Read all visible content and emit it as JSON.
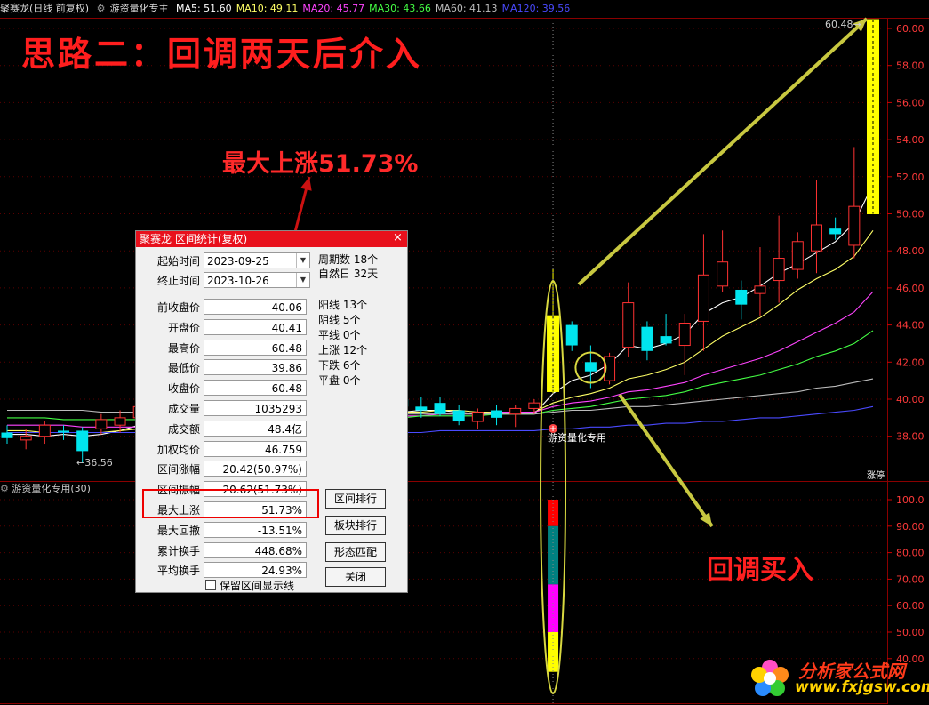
{
  "header": {
    "stock": "聚赛龙",
    "period": "(日线 前复权)",
    "indicator": "游资量化专主",
    "ma": [
      {
        "label": "MA5: 51.60",
        "color": "#ffffff"
      },
      {
        "label": "MA10: 49.11",
        "color": "#ffff66"
      },
      {
        "label": "MA20: 45.77",
        "color": "#ff44ff"
      },
      {
        "label": "MA30: 43.66",
        "color": "#44ff44"
      },
      {
        "label": "MA60: 41.13",
        "color": "#bbbbbb"
      },
      {
        "label": "MA120: 39.56",
        "color": "#4a4aff"
      }
    ]
  },
  "sub_panel_title": "游资量化专用(30)",
  "big_title": "思路二：回调两天后介入",
  "anno_max": "最大上涨51.73%",
  "anno_buy": "回调买入",
  "signal_label": "游资量化专用",
  "low_label": "36.56",
  "high_label": "60.48",
  "zhangting_label": "涨停",
  "dialog": {
    "title": "聚赛龙 区间统计(复权)",
    "close": "×",
    "start_label": "起始时间",
    "start_value": "2023-09-25",
    "end_label": "终止时间",
    "end_value": "2023-10-26",
    "fields": [
      {
        "label": "前收盘价",
        "value": "40.06"
      },
      {
        "label": "开盘价",
        "value": "40.41"
      },
      {
        "label": "最高价",
        "value": "60.48"
      },
      {
        "label": "最低价",
        "value": "39.86"
      },
      {
        "label": "收盘价",
        "value": "60.48"
      },
      {
        "label": "成交量",
        "value": "1035293"
      },
      {
        "label": "成交额",
        "value": "48.4亿"
      },
      {
        "label": "加权均价",
        "value": "46.759"
      },
      {
        "label": "区间涨幅",
        "value": "20.42(50.97%)"
      },
      {
        "label": "区间振幅",
        "value": "20.62(51.73%)"
      },
      {
        "label": "最大上涨",
        "value": "51.73%"
      },
      {
        "label": "最大回撤",
        "value": "-13.51%"
      },
      {
        "label": "累计换手",
        "value": "448.68%"
      },
      {
        "label": "平均换手",
        "value": "24.93%"
      }
    ],
    "stats": [
      "周期数 18个",
      "自然日 32天",
      "阳线 13个",
      "阴线 5个",
      "平线 0个",
      "上涨 12个",
      "下跌 6个",
      "平盘 0个"
    ],
    "buttons": [
      "区间排行",
      "板块排行",
      "形态匹配",
      "关闭"
    ],
    "checkbox_label": "保留区间显示线"
  },
  "logo": {
    "name": "分析家公式网",
    "url": "www.fxjgsw.com"
  },
  "chart_data": {
    "type": "candlestick",
    "y_ticks_main": [
      "60.00",
      "58.00",
      "56.00",
      "54.00",
      "52.00",
      "50.00",
      "48.00",
      "46.00",
      "44.00",
      "42.00",
      "40.00",
      "38.00"
    ],
    "y_ticks_sub": [
      "100.0",
      "90.00",
      "80.00",
      "70.00",
      "60.00",
      "50.00",
      "40.00"
    ],
    "ylim_main": [
      36,
      61
    ],
    "ylim_sub": [
      35,
      105
    ],
    "up_color": "#ff3232",
    "down_color": "#00e5ee",
    "candles": [
      {
        "o": 38.2,
        "h": 38.6,
        "l": 37.6,
        "c": 37.9
      },
      {
        "o": 37.8,
        "h": 38.4,
        "l": 37.3,
        "c": 38.0
      },
      {
        "o": 38.0,
        "h": 38.8,
        "l": 37.6,
        "c": 38.6
      },
      {
        "o": 38.3,
        "h": 38.6,
        "l": 37.8,
        "c": 38.2
      },
      {
        "o": 38.3,
        "h": 38.5,
        "l": 36.56,
        "c": 37.2
      },
      {
        "o": 38.4,
        "h": 39.2,
        "l": 38.1,
        "c": 38.9
      },
      {
        "o": 38.6,
        "h": 39.4,
        "l": 38.2,
        "c": 39.0
      },
      {
        "o": 39.0,
        "h": 40.1,
        "l": 38.6,
        "c": 39.6
      },
      {
        "o": 40.0,
        "h": 40.2,
        "l": 38.7,
        "c": 39.3
      },
      {
        "o": 39.8,
        "h": 40.1,
        "l": 39.3,
        "c": 39.5
      },
      {
        "o": 39.6,
        "h": 40.2,
        "l": 38.9,
        "c": 38.9
      },
      {
        "o": 39.0,
        "h": 39.5,
        "l": 38.4,
        "c": 38.7
      },
      {
        "o": 38.6,
        "h": 39.2,
        "l": 38.3,
        "c": 39.1
      },
      {
        "o": 39.2,
        "h": 39.8,
        "l": 38.9,
        "c": 38.9
      },
      {
        "o": 39.0,
        "h": 39.5,
        "l": 38.5,
        "c": 39.4
      },
      {
        "o": 39.4,
        "h": 40.0,
        "l": 38.6,
        "c": 39.8
      },
      {
        "o": 40.0,
        "h": 40.3,
        "l": 39.0,
        "c": 39.3
      },
      {
        "o": 39.3,
        "h": 40.0,
        "l": 38.5,
        "c": 39.6
      },
      {
        "o": 39.8,
        "h": 40.3,
        "l": 38.6,
        "c": 39.1
      },
      {
        "o": 39.2,
        "h": 39.8,
        "l": 38.8,
        "c": 38.9
      },
      {
        "o": 39.0,
        "h": 39.8,
        "l": 38.6,
        "c": 39.4
      },
      {
        "o": 40.0,
        "h": 40.3,
        "l": 39.4,
        "c": 39.6
      },
      {
        "o": 39.6,
        "h": 40.1,
        "l": 39.0,
        "c": 39.4
      },
      {
        "o": 39.8,
        "h": 40.1,
        "l": 39.1,
        "c": 39.2
      },
      {
        "o": 39.4,
        "h": 39.7,
        "l": 38.6,
        "c": 38.8
      },
      {
        "o": 38.8,
        "h": 39.5,
        "l": 38.4,
        "c": 39.3
      },
      {
        "o": 39.4,
        "h": 39.7,
        "l": 38.6,
        "c": 39.0
      },
      {
        "o": 39.2,
        "h": 39.7,
        "l": 38.5,
        "c": 39.5
      },
      {
        "o": 39.5,
        "h": 40.0,
        "l": 39.2,
        "c": 39.8
      },
      {
        "o": 40.41,
        "h": 47.0,
        "l": 40.3,
        "c": 44.5
      },
      {
        "o": 44.0,
        "h": 44.2,
        "l": 42.6,
        "c": 42.9
      },
      {
        "o": 42.0,
        "h": 42.9,
        "l": 40.6,
        "c": 41.5
      },
      {
        "o": 41.0,
        "h": 42.5,
        "l": 40.8,
        "c": 42.3
      },
      {
        "o": 42.8,
        "h": 46.3,
        "l": 42.3,
        "c": 45.2
      },
      {
        "o": 43.9,
        "h": 44.2,
        "l": 42.1,
        "c": 42.6
      },
      {
        "o": 43.4,
        "h": 44.6,
        "l": 42.9,
        "c": 43.0
      },
      {
        "o": 42.9,
        "h": 44.6,
        "l": 41.3,
        "c": 44.1
      },
      {
        "o": 44.2,
        "h": 48.9,
        "l": 42.6,
        "c": 46.7
      },
      {
        "o": 46.1,
        "h": 49.1,
        "l": 45.8,
        "c": 47.4
      },
      {
        "o": 45.9,
        "h": 46.4,
        "l": 44.3,
        "c": 45.1
      },
      {
        "o": 45.7,
        "h": 48.2,
        "l": 44.5,
        "c": 46.1
      },
      {
        "o": 46.4,
        "h": 49.9,
        "l": 45.2,
        "c": 47.6
      },
      {
        "o": 47.0,
        "h": 49.0,
        "l": 46.5,
        "c": 48.5
      },
      {
        "o": 48.0,
        "h": 51.8,
        "l": 46.8,
        "c": 49.4
      },
      {
        "o": 49.2,
        "h": 49.8,
        "l": 48.6,
        "c": 48.9
      },
      {
        "o": 48.3,
        "h": 53.6,
        "l": 47.6,
        "c": 50.4
      },
      {
        "o": 50.0,
        "h": 60.48,
        "l": 50.0,
        "c": 60.48
      }
    ],
    "sub_bar_segments": [
      {
        "color": "#ff0000",
        "from": 100,
        "to": 90
      },
      {
        "color": "#008080",
        "from": 90,
        "to": 68
      },
      {
        "color": "#ff00ff",
        "from": 68,
        "to": 50
      },
      {
        "color": "#ffff00",
        "from": 50,
        "to": 35
      }
    ],
    "ma_series": [
      {
        "name": "MA5",
        "color": "#ffffff",
        "values": [
          38.1,
          38.1,
          38.0,
          38.1,
          38.0,
          38.1,
          38.3,
          38.6,
          38.9,
          39.2,
          39.3,
          39.3,
          39.2,
          39.1,
          39.1,
          39.2,
          39.3,
          39.4,
          39.5,
          39.4,
          39.3,
          39.3,
          39.4,
          39.4,
          39.3,
          39.2,
          39.2,
          39.2,
          39.2,
          40.3,
          41.0,
          41.3,
          41.9,
          42.9,
          42.7,
          43.0,
          43.5,
          44.6,
          45.2,
          45.5,
          46.1,
          46.8,
          47.3,
          47.9,
          48.5,
          49.5,
          51.6
        ]
      },
      {
        "name": "MA10",
        "color": "#ffff66",
        "values": [
          38.3,
          38.3,
          38.2,
          38.2,
          38.2,
          38.2,
          38.3,
          38.4,
          38.5,
          38.6,
          38.7,
          38.8,
          38.9,
          39.0,
          39.1,
          39.2,
          39.3,
          39.3,
          39.3,
          39.3,
          39.3,
          39.3,
          39.3,
          39.4,
          39.4,
          39.3,
          39.3,
          39.3,
          39.3,
          39.8,
          40.1,
          40.3,
          40.6,
          41.1,
          41.3,
          41.6,
          42.0,
          42.7,
          43.4,
          43.9,
          44.4,
          45.1,
          45.9,
          46.5,
          47.0,
          47.7,
          49.1
        ]
      },
      {
        "name": "MA20",
        "color": "#ff44ff",
        "values": [
          38.6,
          38.6,
          38.6,
          38.6,
          38.5,
          38.5,
          38.5,
          38.5,
          38.5,
          38.5,
          38.5,
          38.6,
          38.6,
          38.7,
          38.7,
          38.8,
          38.8,
          38.9,
          39.0,
          39.0,
          39.0,
          39.1,
          39.1,
          39.2,
          39.2,
          39.2,
          39.3,
          39.3,
          39.3,
          39.6,
          39.8,
          39.9,
          40.1,
          40.4,
          40.5,
          40.7,
          40.9,
          41.3,
          41.6,
          41.9,
          42.2,
          42.6,
          43.1,
          43.6,
          44.1,
          44.7,
          45.8
        ]
      },
      {
        "name": "MA30",
        "color": "#44ff44",
        "values": [
          39.0,
          39.0,
          39.0,
          38.9,
          38.9,
          38.9,
          38.9,
          38.9,
          38.8,
          38.8,
          38.8,
          38.8,
          38.8,
          38.8,
          38.8,
          38.8,
          38.9,
          38.9,
          38.9,
          39.0,
          39.0,
          39.0,
          39.1,
          39.1,
          39.1,
          39.1,
          39.2,
          39.2,
          39.2,
          39.4,
          39.5,
          39.6,
          39.8,
          40.0,
          40.1,
          40.2,
          40.4,
          40.7,
          40.9,
          41.1,
          41.3,
          41.6,
          41.9,
          42.3,
          42.6,
          43.0,
          43.7
        ]
      },
      {
        "name": "MA60",
        "color": "#bbbbbb",
        "values": [
          39.4,
          39.4,
          39.4,
          39.4,
          39.4,
          39.3,
          39.3,
          39.3,
          39.3,
          39.3,
          39.3,
          39.3,
          39.3,
          39.3,
          39.2,
          39.2,
          39.2,
          39.2,
          39.2,
          39.2,
          39.2,
          39.2,
          39.2,
          39.2,
          39.2,
          39.2,
          39.2,
          39.2,
          39.2,
          39.3,
          39.4,
          39.4,
          39.5,
          39.6,
          39.6,
          39.7,
          39.8,
          39.9,
          40.0,
          40.1,
          40.2,
          40.3,
          40.4,
          40.6,
          40.7,
          40.9,
          41.1
        ]
      },
      {
        "name": "MA120",
        "color": "#4a4aff",
        "values": [
          38.2,
          38.2,
          38.2,
          38.2,
          38.2,
          38.2,
          38.2,
          38.2,
          38.2,
          38.2,
          38.2,
          38.2,
          38.2,
          38.2,
          38.2,
          38.2,
          38.2,
          38.2,
          38.2,
          38.2,
          38.2,
          38.2,
          38.2,
          38.3,
          38.3,
          38.3,
          38.3,
          38.3,
          38.3,
          38.4,
          38.4,
          38.5,
          38.5,
          38.6,
          38.6,
          38.7,
          38.7,
          38.8,
          38.8,
          38.9,
          39.0,
          39.0,
          39.1,
          39.2,
          39.3,
          39.4,
          39.6
        ]
      }
    ]
  }
}
